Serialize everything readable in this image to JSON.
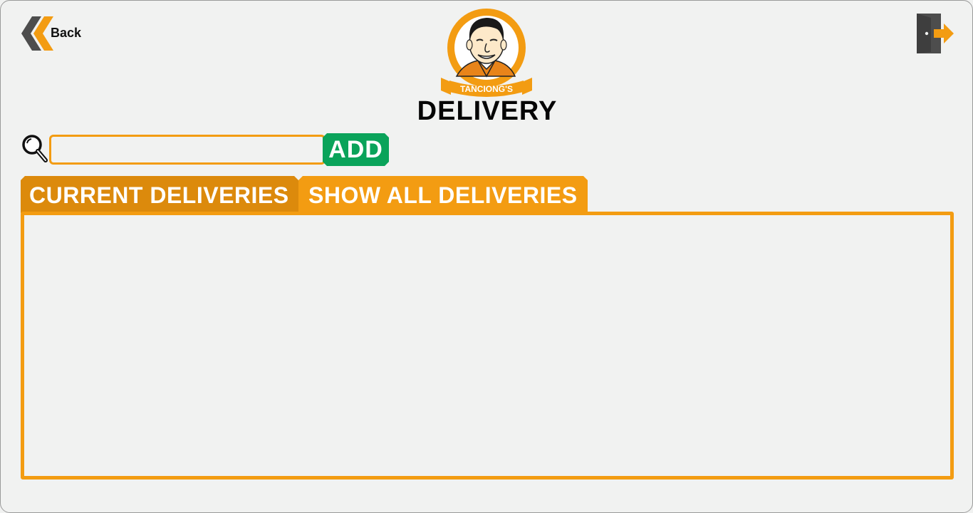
{
  "header": {
    "back_label": "Back",
    "title": "DELIVERY"
  },
  "logo": {
    "text": "TANCIONG'S"
  },
  "search": {
    "value": "",
    "placeholder": ""
  },
  "toolbar": {
    "add_label": "ADD"
  },
  "tabs": [
    {
      "label": "CURRENT DELIVERIES",
      "active": true
    },
    {
      "label": "SHOW ALL DELIVERIES",
      "active": false
    }
  ],
  "deliveries": [],
  "colors": {
    "accent": "#f39c12",
    "accent_dark": "#dc8a0c",
    "add_green": "#0aa35a",
    "background": "#f1f2f1",
    "icon_gray": "#4d4d4d"
  },
  "icons": {
    "back": "double-chevron-left-icon",
    "logout": "logout-door-icon",
    "search": "magnifier-icon"
  }
}
